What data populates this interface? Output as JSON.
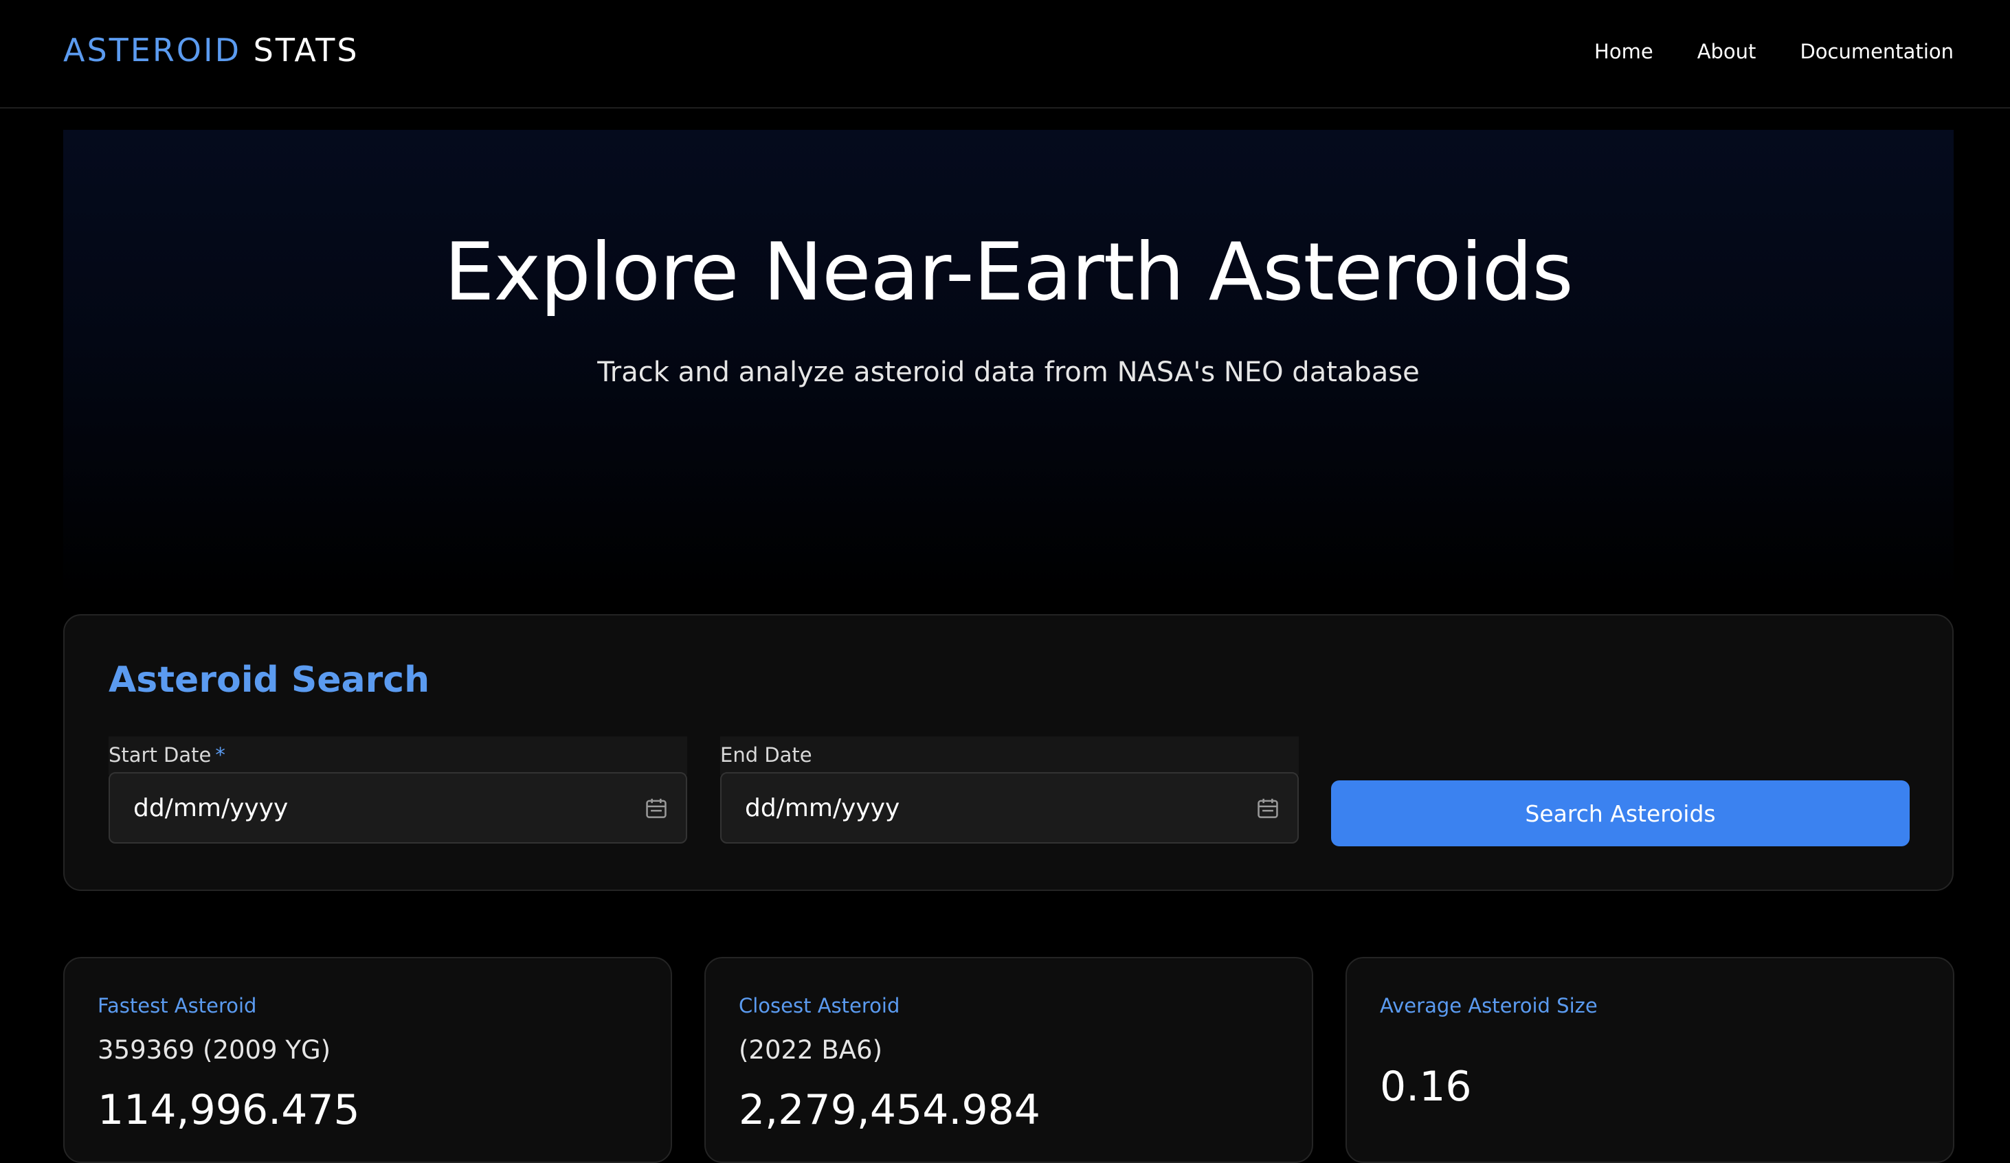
{
  "navbar": {
    "brand_accent": "ASTEROID",
    "brand_rest": "STATS",
    "links": [
      "Home",
      "About",
      "Documentation"
    ]
  },
  "hero": {
    "title": "Explore Near-Earth Asteroids",
    "subtitle": "Track and analyze asteroid data from NASA's NEO database"
  },
  "search": {
    "title": "Asteroid Search",
    "start_label": "Start Date",
    "start_required_marker": "*",
    "start_value": "dd/mm/yyyy",
    "end_label": "End Date",
    "end_value": "dd/mm/yyyy",
    "button_label": "Search Asteroids",
    "calendar_icon": "calendar-icon"
  },
  "stats": [
    {
      "label": "Fastest Asteroid",
      "name": "359369 (2009 YG)",
      "value": "114,996.475"
    },
    {
      "label": "Closest Asteroid",
      "name": "(2022 BA6)",
      "value": "2,279,454.984"
    },
    {
      "label": "Average Asteroid Size",
      "name": "",
      "value": "0.16"
    }
  ],
  "colors": {
    "accent": "#5b9bf0",
    "button": "#3b82f0",
    "background": "#000000",
    "card": "#0d0d0d"
  }
}
